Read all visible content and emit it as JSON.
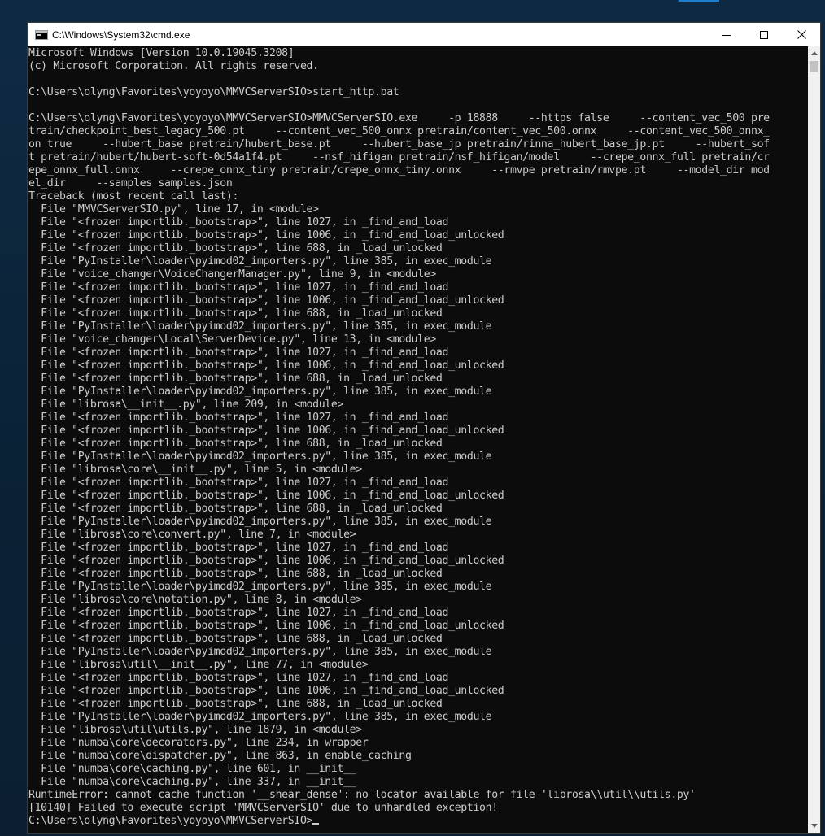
{
  "window": {
    "title": "C:\\Windows\\System32\\cmd.exe",
    "icon": "console-icon"
  },
  "caption_buttons": {
    "minimize": "minimize-icon",
    "maximize": "maximize-icon",
    "close": "close-icon"
  },
  "console": {
    "lines": [
      "Microsoft Windows [Version 10.0.19045.3208]",
      "(c) Microsoft Corporation. All rights reserved.",
      "",
      "C:\\Users\\olyng\\Favorites\\yoyoyo\\MMVCServerSIO>start_http.bat",
      "",
      "C:\\Users\\olyng\\Favorites\\yoyoyo\\MMVCServerSIO>MMVCServerSIO.exe     -p 18888     --https false     --content_vec_500 pre",
      "train/checkpoint_best_legacy_500.pt     --content_vec_500_onnx pretrain/content_vec_500.onnx     --content_vec_500_onnx_",
      "on true     --hubert_base pretrain/hubert_base.pt     --hubert_base_jp pretrain/rinna_hubert_base_jp.pt     --hubert_sof",
      "t pretrain/hubert/hubert-soft-0d54a1f4.pt     --nsf_hifigan pretrain/nsf_hifigan/model     --crepe_onnx_full pretrain/cr",
      "epe_onnx_full.onnx     --crepe_onnx_tiny pretrain/crepe_onnx_tiny.onnx     --rmvpe pretrain/rmvpe.pt     --model_dir mod",
      "el_dir     --samples samples.json",
      "Traceback (most recent call last):",
      "  File \"MMVCServerSIO.py\", line 17, in <module>",
      "  File \"<frozen importlib._bootstrap>\", line 1027, in _find_and_load",
      "  File \"<frozen importlib._bootstrap>\", line 1006, in _find_and_load_unlocked",
      "  File \"<frozen importlib._bootstrap>\", line 688, in _load_unlocked",
      "  File \"PyInstaller\\loader\\pyimod02_importers.py\", line 385, in exec_module",
      "  File \"voice_changer\\VoiceChangerManager.py\", line 9, in <module>",
      "  File \"<frozen importlib._bootstrap>\", line 1027, in _find_and_load",
      "  File \"<frozen importlib._bootstrap>\", line 1006, in _find_and_load_unlocked",
      "  File \"<frozen importlib._bootstrap>\", line 688, in _load_unlocked",
      "  File \"PyInstaller\\loader\\pyimod02_importers.py\", line 385, in exec_module",
      "  File \"voice_changer\\Local\\ServerDevice.py\", line 13, in <module>",
      "  File \"<frozen importlib._bootstrap>\", line 1027, in _find_and_load",
      "  File \"<frozen importlib._bootstrap>\", line 1006, in _find_and_load_unlocked",
      "  File \"<frozen importlib._bootstrap>\", line 688, in _load_unlocked",
      "  File \"PyInstaller\\loader\\pyimod02_importers.py\", line 385, in exec_module",
      "  File \"librosa\\__init__.py\", line 209, in <module>",
      "  File \"<frozen importlib._bootstrap>\", line 1027, in _find_and_load",
      "  File \"<frozen importlib._bootstrap>\", line 1006, in _find_and_load_unlocked",
      "  File \"<frozen importlib._bootstrap>\", line 688, in _load_unlocked",
      "  File \"PyInstaller\\loader\\pyimod02_importers.py\", line 385, in exec_module",
      "  File \"librosa\\core\\__init__.py\", line 5, in <module>",
      "  File \"<frozen importlib._bootstrap>\", line 1027, in _find_and_load",
      "  File \"<frozen importlib._bootstrap>\", line 1006, in _find_and_load_unlocked",
      "  File \"<frozen importlib._bootstrap>\", line 688, in _load_unlocked",
      "  File \"PyInstaller\\loader\\pyimod02_importers.py\", line 385, in exec_module",
      "  File \"librosa\\core\\convert.py\", line 7, in <module>",
      "  File \"<frozen importlib._bootstrap>\", line 1027, in _find_and_load",
      "  File \"<frozen importlib._bootstrap>\", line 1006, in _find_and_load_unlocked",
      "  File \"<frozen importlib._bootstrap>\", line 688, in _load_unlocked",
      "  File \"PyInstaller\\loader\\pyimod02_importers.py\", line 385, in exec_module",
      "  File \"librosa\\core\\notation.py\", line 8, in <module>",
      "  File \"<frozen importlib._bootstrap>\", line 1027, in _find_and_load",
      "  File \"<frozen importlib._bootstrap>\", line 1006, in _find_and_load_unlocked",
      "  File \"<frozen importlib._bootstrap>\", line 688, in _load_unlocked",
      "  File \"PyInstaller\\loader\\pyimod02_importers.py\", line 385, in exec_module",
      "  File \"librosa\\util\\__init__.py\", line 77, in <module>",
      "  File \"<frozen importlib._bootstrap>\", line 1027, in _find_and_load",
      "  File \"<frozen importlib._bootstrap>\", line 1006, in _find_and_load_unlocked",
      "  File \"<frozen importlib._bootstrap>\", line 688, in _load_unlocked",
      "  File \"PyInstaller\\loader\\pyimod02_importers.py\", line 385, in exec_module",
      "  File \"librosa\\util\\utils.py\", line 1879, in <module>",
      "  File \"numba\\core\\decorators.py\", line 234, in wrapper",
      "  File \"numba\\core\\dispatcher.py\", line 863, in enable_caching",
      "  File \"numba\\core\\caching.py\", line 601, in __init__",
      "  File \"numba\\core\\caching.py\", line 337, in __init__",
      "RuntimeError: cannot cache function '__shear_dense': no locator available for file 'librosa\\\\util\\\\utils.py'",
      "[10140] Failed to execute script 'MMVCServerSIO' due to unhandled exception!"
    ],
    "prompt": "C:\\Users\\olyng\\Favorites\\yoyoyo\\MMVCServerSIO>"
  },
  "colors": {
    "console_bg": "#0c0c0c",
    "console_fg": "#cccccc",
    "titlebar_bg": "#ffffff"
  }
}
